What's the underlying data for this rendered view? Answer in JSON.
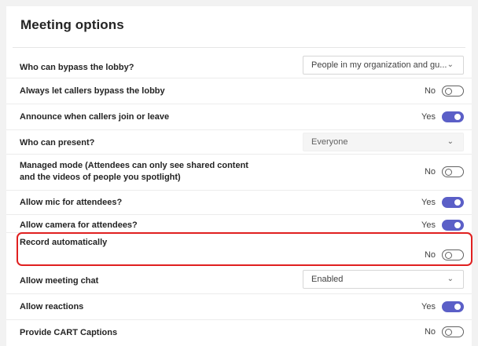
{
  "title": "Meeting options",
  "options": [
    {
      "label": "Who can bypass the lobby?",
      "type": "select",
      "value": "People in my organization and gu..."
    },
    {
      "label": "Always let callers bypass the lobby",
      "type": "toggle",
      "state": "No",
      "on": false
    },
    {
      "label": "Announce when callers join or leave",
      "type": "toggle",
      "state": "Yes",
      "on": true
    },
    {
      "label": "Who can present?",
      "type": "select",
      "value": "Everyone",
      "disabled": true
    },
    {
      "label_line1": "Managed mode (Attendees can only see shared content",
      "label_line2": "and the videos of people you spotlight)",
      "type": "toggle",
      "state": "No",
      "on": false
    },
    {
      "label": "Allow mic for attendees?",
      "type": "toggle",
      "state": "Yes",
      "on": true
    },
    {
      "label": "Allow camera for attendees?",
      "type": "toggle",
      "state": "Yes",
      "on": true
    },
    {
      "label": "Record automatically",
      "type": "toggle",
      "state": "No",
      "on": false
    },
    {
      "label": "Allow meeting chat",
      "type": "select",
      "value": "Enabled"
    },
    {
      "label": "Allow reactions",
      "type": "toggle",
      "state": "Yes",
      "on": true
    },
    {
      "label": "Provide CART Captions",
      "type": "toggle",
      "state": "No",
      "on": false
    }
  ],
  "colors": {
    "accent": "#5b5fc7",
    "highlight": "#e02020"
  }
}
